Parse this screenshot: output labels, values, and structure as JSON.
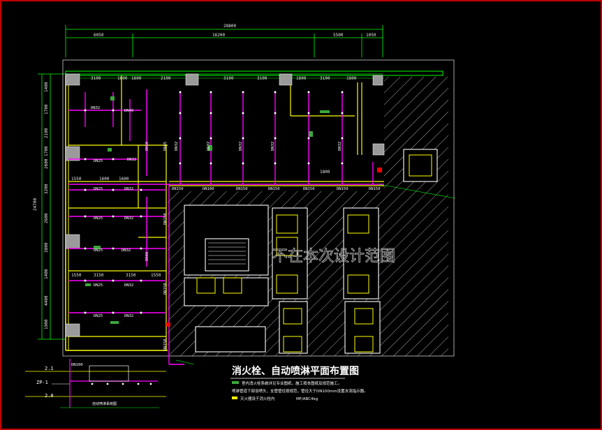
{
  "drawing": {
    "title": "消火栓、自动喷淋平面布置图",
    "scope_note": "不在本次设计范围",
    "extinguisher_note": "MF/ABC4kg",
    "note_line1": "室内消火栓系统详见专业图纸，施工按本图纸及规范施工。",
    "note_line2": "喷淋管道下部设喷头，支管管径按规范，管径大于DN100mm设置水流指示器。",
    "note_line3": "灭火器设于消火栓内",
    "riser_label": "自动喷淋系统图"
  },
  "dimensions": {
    "top_total": "28800",
    "top_segments": [
      "6050",
      "16200",
      "5500",
      "1050"
    ],
    "left_total": "24700",
    "grid_top": [
      "3100",
      "1600",
      "1600",
      "2100",
      "2100",
      "3100",
      "3100",
      "3100",
      "1800",
      "1800"
    ],
    "left_side": [
      "1400",
      "1700",
      "2100",
      "1700",
      "2600",
      "3200",
      "2600",
      "3800",
      "1400",
      "4400",
      "1900"
    ],
    "mid_row": [
      "1550",
      "1600",
      "1600"
    ],
    "low_row": [
      "1550",
      "3150",
      "3150",
      "1550"
    ],
    "corridor": [
      "1800",
      "1800"
    ]
  },
  "pipe_labels": {
    "dn32": "DN32",
    "dn40": "DN40",
    "dn25": "DN25",
    "dn50": "DN50",
    "dn65": "DN65",
    "dn80": "DN80",
    "dn100": "DN100",
    "dn150": "DN150",
    "dn100_riser": "DN100"
  },
  "riser": {
    "level_top": "2.1",
    "level_mid": "ZP-1",
    "level_bot": "2.0"
  },
  "colors": {
    "pipe": "#ff00ff",
    "wall": "#ffff00",
    "dimension": "#00ff00",
    "hatch": "#cfcfcf",
    "frame": "#c00000"
  }
}
